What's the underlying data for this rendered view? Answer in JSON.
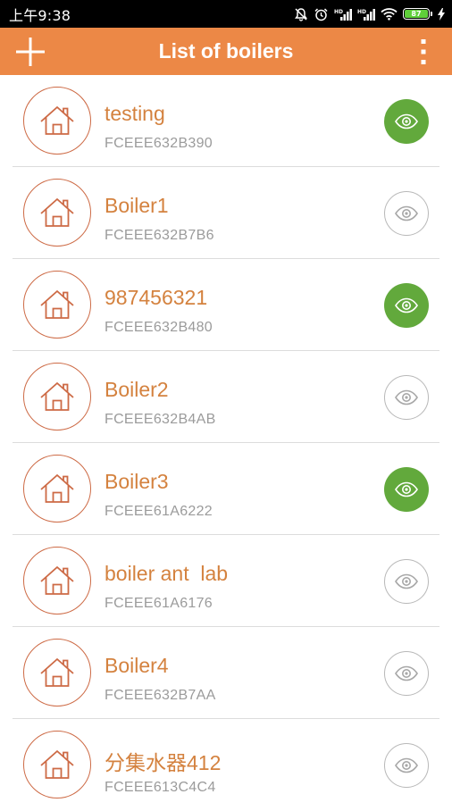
{
  "status_bar": {
    "time": "上午9:38",
    "battery": "87",
    "icons": [
      "alarm-off-icon",
      "alarm-clock-icon",
      "signal-hd-icon",
      "signal-hd-icon",
      "wifi-icon",
      "battery-icon",
      "charging-icon"
    ]
  },
  "app_bar": {
    "title": "List of boilers",
    "add_icon": "plus-icon",
    "menu_icon": "more-vertical-icon"
  },
  "colors": {
    "accent": "#ec8846",
    "name_text": "#d4823f",
    "house_circle": "#cd6a45",
    "eye_active": "#62a93c",
    "id_text": "#9b9b9b"
  },
  "boilers": [
    {
      "name": "testing",
      "id": "FCEEE632B390",
      "visible": true
    },
    {
      "name": "Boiler1",
      "id": "FCEEE632B7B6",
      "visible": false
    },
    {
      "name": "987456321",
      "id": "FCEEE632B480",
      "visible": true
    },
    {
      "name": "Boiler2",
      "id": "FCEEE632B4AB",
      "visible": false
    },
    {
      "name": "Boiler3",
      "id": "FCEEE61A6222",
      "visible": true
    },
    {
      "name": "boiler ant  lab",
      "id": "FCEEE61A6176",
      "visible": false
    },
    {
      "name": "Boiler4",
      "id": "FCEEE632B7AA",
      "visible": false
    },
    {
      "name": "分集水器412",
      "id": "FCEEE613C4C4",
      "visible": false
    }
  ]
}
